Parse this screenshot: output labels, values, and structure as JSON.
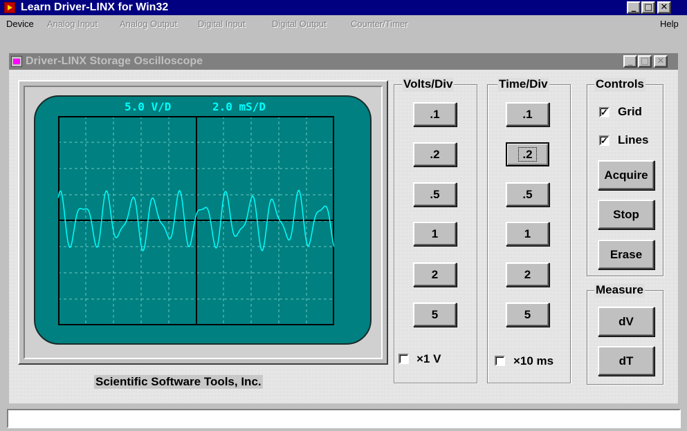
{
  "app": {
    "title": "Learn Driver-LINX for Win32"
  },
  "menu": {
    "items": [
      "Device",
      "Analog Input",
      "Analog Output",
      "Digital Input",
      "Digital Output",
      "Counter/Timer"
    ],
    "help": "Help"
  },
  "child": {
    "title": "Driver-LINX Storage Oscilloscope"
  },
  "scope": {
    "volts_readout": "5.0 V/D",
    "time_readout": "2.0 mS/D",
    "trace_color": "#00ffff",
    "screen_color": "#008080",
    "grid_color": "#6ec8c8"
  },
  "company": "Scientific Software Tools, Inc.",
  "volts": {
    "title": "Volts/Div",
    "buttons": [
      ".1",
      ".2",
      ".5",
      "1",
      "2",
      "5"
    ],
    "x1_label": "×1 V",
    "x1_checked": false
  },
  "time": {
    "title": "Time/Div",
    "buttons": [
      ".1",
      ".2",
      ".5",
      "1",
      "2",
      "5"
    ],
    "selected": ".2",
    "x10_label": "×10 ms",
    "x10_checked": false
  },
  "controls": {
    "title": "Controls",
    "grid_label": "Grid",
    "grid_checked": true,
    "lines_label": "Lines",
    "lines_checked": true,
    "acquire": "Acquire",
    "stop": "Stop",
    "erase": "Erase"
  },
  "measure": {
    "title": "Measure",
    "dv": "dV",
    "dt": "dT"
  },
  "status": {
    "text": ""
  },
  "icons": {
    "app": "driver-linx-app-icon",
    "child": "oscilloscope-icon",
    "minimize": "minimize-icon",
    "maximize": "maximize-icon",
    "close": "close-icon"
  }
}
